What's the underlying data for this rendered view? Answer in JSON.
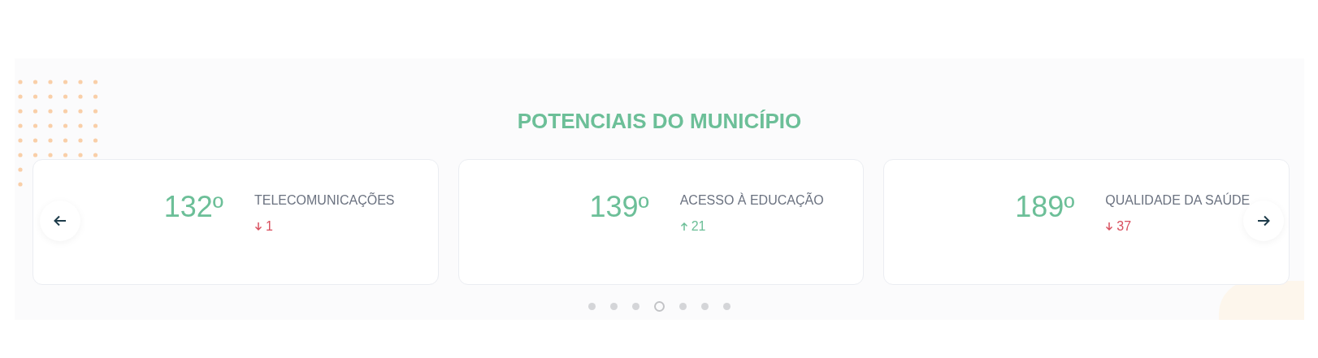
{
  "section": {
    "title": "POTENCIAIS DO MUNICÍPIO"
  },
  "cards": [
    {
      "rank": "132º",
      "label": "TELECOMUNICAÇÕES",
      "rising": false,
      "change": "1"
    },
    {
      "rank": "139º",
      "label": "ACESSO À EDUCAÇÃO",
      "rising": true,
      "change": "21"
    },
    {
      "rank": "189º",
      "label": "QUALIDADE DA SAÚDE",
      "rising": false,
      "change": "37"
    }
  ],
  "pagination": [
    {
      "selected": false
    },
    {
      "selected": false
    },
    {
      "selected": false
    },
    {
      "selected": true
    },
    {
      "selected": false
    },
    {
      "selected": false
    },
    {
      "selected": false
    }
  ]
}
